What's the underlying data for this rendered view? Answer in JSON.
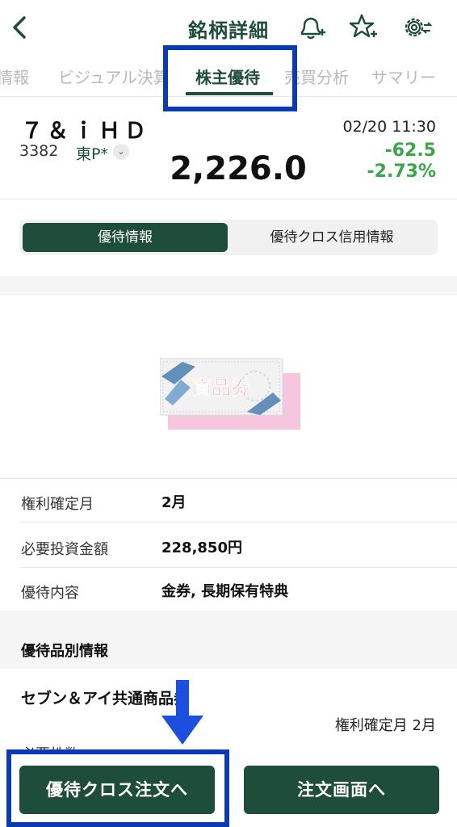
{
  "header": {
    "title": "銘柄詳細",
    "back_icon": "chevron-left-icon",
    "bell_icon": "bell-plus-icon",
    "star_icon": "star-plus-icon",
    "gear_icon": "gear-swap-icon"
  },
  "tabs": [
    {
      "label": "株価情報",
      "visible": "情報",
      "active": false
    },
    {
      "label": "ビジュアル決算",
      "active": false
    },
    {
      "label": "株主優待",
      "active": true
    },
    {
      "label": "売買分析",
      "active": false
    },
    {
      "label": "サマリー",
      "active": false
    }
  ],
  "stock": {
    "name": "７＆ｉＨＤ",
    "code": "3382",
    "market": "東P*",
    "price": "2,226.0",
    "time": "02/20 11:30",
    "change": "-62.5",
    "change_pct": "-2.73%"
  },
  "segment": {
    "active": "優待情報",
    "inactive": "優待クロス信用情報"
  },
  "benefit_image": {
    "label": "商品券"
  },
  "info_rows": [
    {
      "label": "権利確定月",
      "value": "2月"
    },
    {
      "label": "必要投資金額",
      "value": "228,850円"
    },
    {
      "label": "優待内容",
      "value": "金券, 長期保有特典"
    }
  ],
  "section": {
    "title": "優待品別情報",
    "item_name": "セブン＆アイ共通商品券",
    "item_right": "権利確定月  2月",
    "item_cut": "必要株数"
  },
  "buttons": {
    "cross_order": "優待クロス注文へ",
    "order_screen": "注文画面へ"
  },
  "colors": {
    "brand": "#1e4d3b",
    "negative": "#3aa64a",
    "annotation": "#0a3bb0"
  }
}
